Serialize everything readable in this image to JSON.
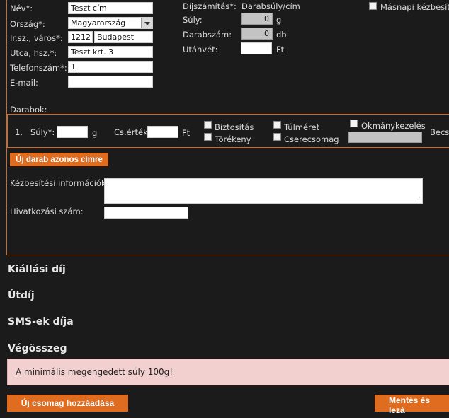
{
  "form": {
    "name_label": "Név*:",
    "name_value": "Teszt cím",
    "country_label": "Ország*:",
    "country_value": "Magyarország",
    "zip_city_label": "Ir.sz., város*:",
    "zip_value": "1212",
    "city_value": "Budapest",
    "street_label": "Utca, hsz.*:",
    "street_value": "Teszt krt. 3",
    "phone_label": "Telefonszám*:",
    "phone_value": "1",
    "email_label": "E-mail:",
    "email_value": ""
  },
  "pricing": {
    "calc_label": "Díjszámítás*:",
    "calc_value": "Darabsúly/cím",
    "weight_label": "Súly:",
    "weight_value": "0",
    "weight_unit": "g",
    "count_label": "Darabszám:",
    "count_value": "0",
    "count_unit": "db",
    "cod_label": "Utánvét:",
    "cod_value": "",
    "cod_unit": "Ft"
  },
  "next_day_label": "Másnapi kézbesítés",
  "pieces": {
    "title": "Darabok:",
    "row_index": "1.",
    "weight_label": "Súly*:",
    "weight_unit": "g",
    "value_label": "Cs.érték:",
    "value_unit": "Ft",
    "insurance_label": "Biztosítás",
    "fragile_label": "Törékeny",
    "oversize_label": "Túlméret",
    "exchange_label": "Cserecsomag",
    "document_label": "Okmánykezelés",
    "becs_label": "Becsü"
  },
  "new_piece_button": "Új darab azonos címre",
  "delivery_info_label": "Kézbesítési információk:",
  "reference_label": "Hivatkozási szám:",
  "sections": {
    "issue_fee": "Kiállási díj",
    "road_toll": "Útdíj",
    "sms_fee": "SMS-ek díja",
    "total": "Végösszeg"
  },
  "error_message": "A minimális megengedett súly 100g!",
  "add_package_button": "Új csomag hozzáadása",
  "save_button": "Mentés és lezá",
  "colors": {
    "accent": "#e06d1f",
    "background": "#1b1b1b",
    "error_bg": "#f2d0d0"
  }
}
